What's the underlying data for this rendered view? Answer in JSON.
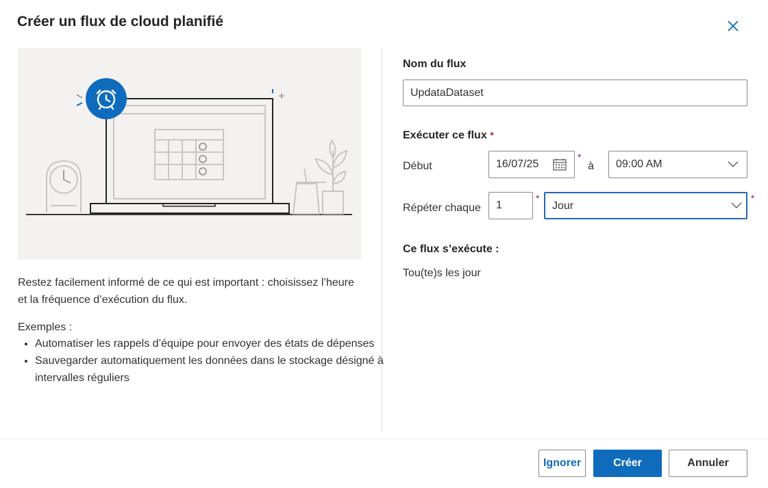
{
  "dialog": {
    "title": "Créer un flux de cloud planifié"
  },
  "left": {
    "description": "Restez facilement informé de ce qui est important : choisissez l’heure et la fréquence d’exécution du flux.",
    "examples_title": "Exemples :",
    "examples": [
      "Automatiser les rappels d’équipe pour envoyer des états de dépenses",
      "Sauvegarder automatiquement les données dans le stockage désigné à intervalles réguliers"
    ]
  },
  "form": {
    "flow_name_label": "Nom du flux",
    "flow_name_value": "UpdataDataset",
    "run_label": "Exécuter ce flux",
    "required_mark": "*",
    "start_label": "Début",
    "start_date": "16/07/25",
    "at_label": "à",
    "start_time": "09:00 AM",
    "repeat_label": "Répéter chaque",
    "repeat_count": "1",
    "repeat_unit": "Jour",
    "summary_label": "Ce flux s’exécute :",
    "summary_value": "Tou(te)s les jour"
  },
  "footer": {
    "ignore_label": "Ignorer",
    "create_label": "Créer",
    "cancel_label": "Annuler"
  },
  "colors": {
    "accent": "#0f6cbd",
    "focus_border": "#2266b7",
    "required": "#a4262c",
    "illustration_bg": "#f3f2f1"
  },
  "icons": [
    "close-icon",
    "alarm-clock-icon",
    "calendar-icon",
    "chevron-down-icon"
  ]
}
